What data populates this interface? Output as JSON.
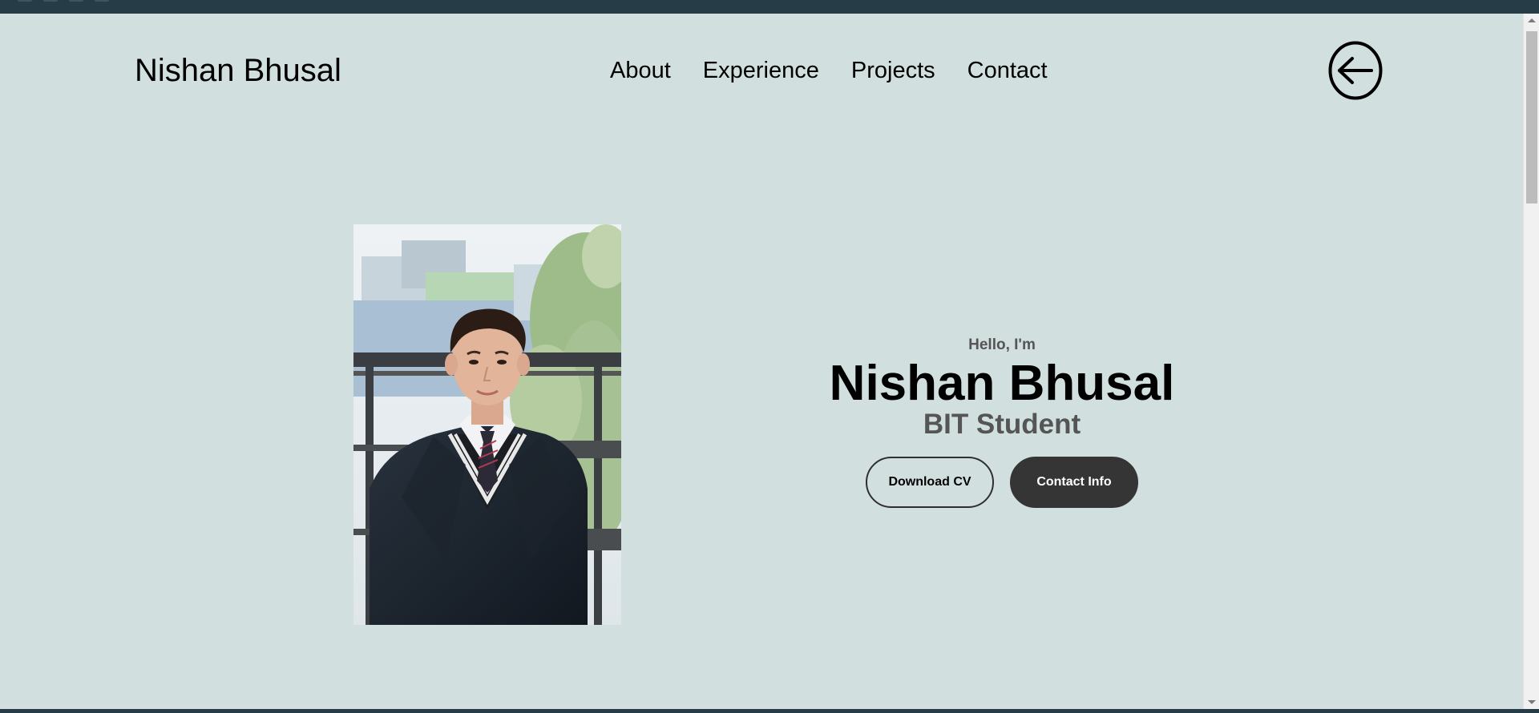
{
  "nav": {
    "logo": "Nishan Bhusal",
    "links": [
      {
        "label": "About"
      },
      {
        "label": "Experience"
      },
      {
        "label": "Projects"
      },
      {
        "label": "Contact"
      }
    ],
    "back_icon": "arrow-left-circle-icon"
  },
  "hero": {
    "greeting": "Hello, I'm",
    "name": "Nishan Bhusal",
    "role": "BIT Student",
    "buttons": {
      "download_cv": "Download CV",
      "contact_info": "Contact Info"
    },
    "photo_alt": "profile photo"
  },
  "colors": {
    "background": "#d1e0df",
    "browser_chrome": "#263c46",
    "text_primary": "#000000",
    "text_secondary": "#555555",
    "button_solid": "#353535"
  }
}
